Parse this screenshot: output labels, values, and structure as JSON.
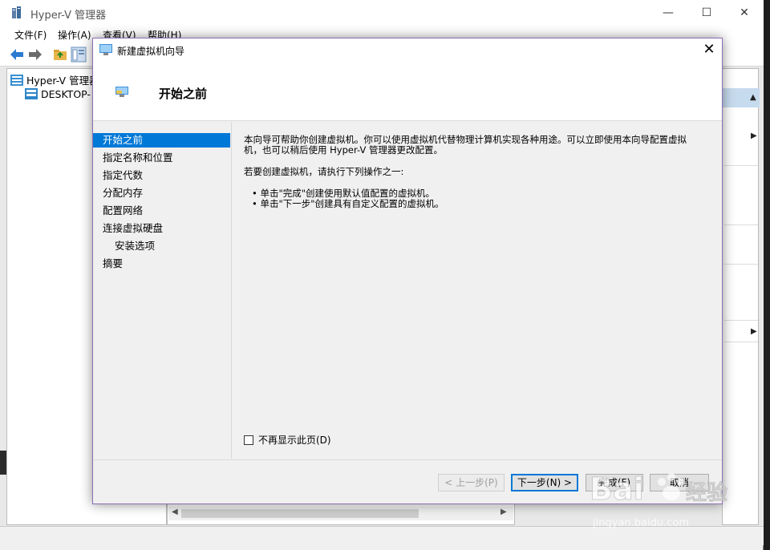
{
  "mmc": {
    "title": "Hyper-V 管理器",
    "window_buttons": {
      "minimize": "—",
      "maximize": "☐",
      "close": "✕"
    },
    "menu": [
      "文件(F)",
      "操作(A)",
      "查看(V)",
      "帮助(H)"
    ],
    "tree": {
      "root": "Hyper-V 管理器",
      "child": "DESKTOP-"
    }
  },
  "wizard": {
    "title": "新建虚拟机向导",
    "close": "✕",
    "header_title": "开始之前",
    "steps": [
      {
        "label": "开始之前",
        "active": true,
        "sub": false
      },
      {
        "label": "指定名称和位置",
        "active": false,
        "sub": false
      },
      {
        "label": "指定代数",
        "active": false,
        "sub": false
      },
      {
        "label": "分配内存",
        "active": false,
        "sub": false
      },
      {
        "label": "配置网络",
        "active": false,
        "sub": false
      },
      {
        "label": "连接虚拟硬盘",
        "active": false,
        "sub": false
      },
      {
        "label": "安装选项",
        "active": false,
        "sub": true
      },
      {
        "label": "摘要",
        "active": false,
        "sub": false
      }
    ],
    "intro_line1": "本向导可帮助你创建虚拟机。你可以使用虚拟机代替物理计算机实现各种用途。可以立即使用本向导配置虚拟",
    "intro_line2": "机，也可以稍后使用 Hyper-V 管理器更改配置。",
    "instruction": "若要创建虚拟机，请执行下列操作之一:",
    "bullet1": "• 单击\"完成\"创建使用默认值配置的虚拟机。",
    "bullet2": "• 单击\"下一步\"创建具有自定义配置的虚拟机。",
    "dont_show": "不再显示此页(D)",
    "buttons": {
      "prev": "< 上一步(P)",
      "next": "下一步(N) >",
      "finish": "完成(F)",
      "cancel": "取消"
    }
  },
  "watermark": {
    "url": "jingyan.baidu.com"
  },
  "colors": {
    "accent": "#0078d7",
    "dialog_border": "#8b6fb3",
    "actions_header": "#c7dbef"
  }
}
